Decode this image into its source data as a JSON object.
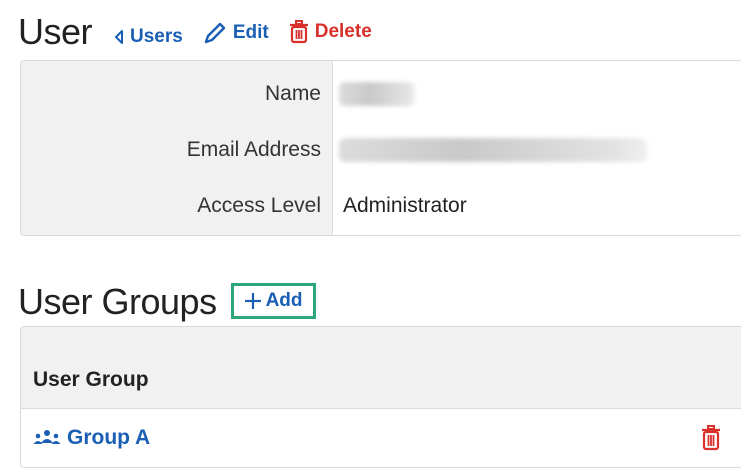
{
  "user_section": {
    "title": "User",
    "back_link": "Users",
    "edit_link": "Edit",
    "delete_link": "Delete"
  },
  "details": [
    {
      "label": "Name",
      "value": "",
      "redacted": true
    },
    {
      "label": "Email Address",
      "value": "",
      "redacted": true
    },
    {
      "label": "Access Level",
      "value": "Administrator",
      "redacted": false
    }
  ],
  "groups_section": {
    "title": "User Groups",
    "add_label": "Add",
    "column_header": "User Group",
    "rows": [
      {
        "name": "Group A"
      }
    ]
  },
  "colors": {
    "link_blue": "#1a5fb4",
    "danger_red": "#d9302c",
    "highlight_green": "#2ba77a",
    "label_bg": "#f1f1f1"
  },
  "icons": {
    "back": "caret-left-icon",
    "edit": "pencil-icon",
    "delete": "trash-icon",
    "add": "plus-icon",
    "group": "users-group-icon"
  }
}
